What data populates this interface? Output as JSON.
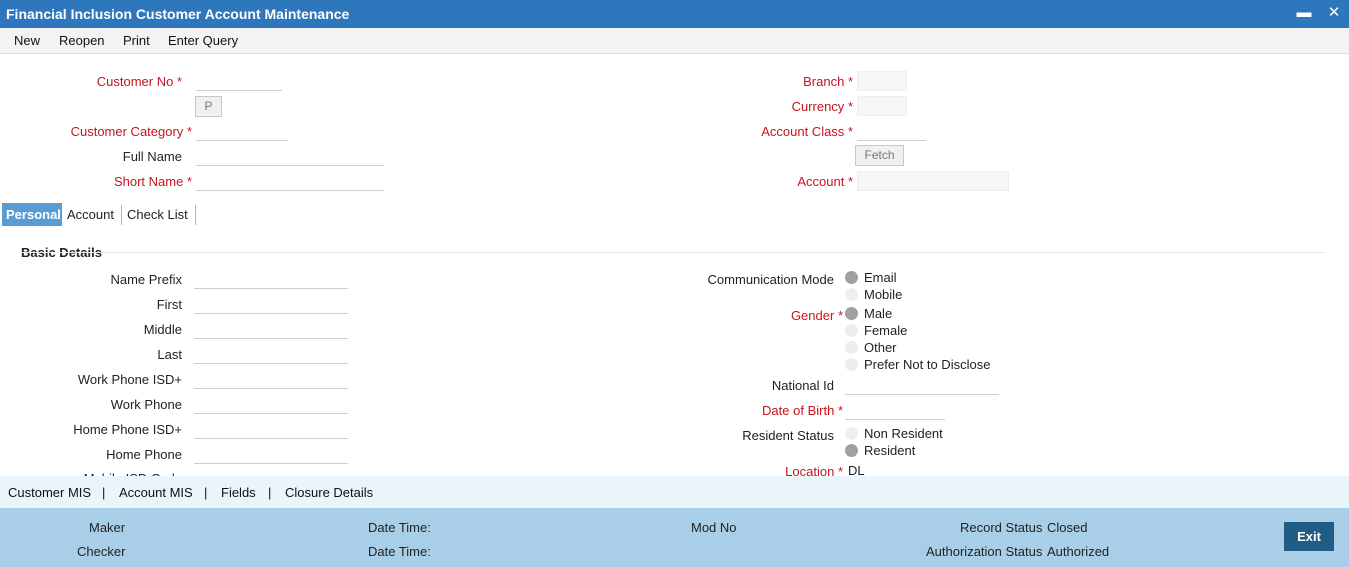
{
  "window": {
    "title": "Financial Inclusion Customer Account Maintenance",
    "minimize_icon": "minimize-icon",
    "close_icon": "close-icon"
  },
  "menu": [
    "New",
    "Reopen",
    "Print",
    "Enter Query"
  ],
  "header_form": {
    "customer_no": {
      "label": "Customer No",
      "required": "*",
      "value": ""
    },
    "p_button": "P",
    "customer_category": {
      "label": "Customer Category",
      "required": "*",
      "value": ""
    },
    "full_name": {
      "label": "Full Name",
      "value": ""
    },
    "short_name": {
      "label": "Short Name",
      "required": "*",
      "value": ""
    },
    "branch": {
      "label": "Branch",
      "required": "*",
      "value": ""
    },
    "currency": {
      "label": "Currency",
      "required": "*",
      "value": ""
    },
    "account_class": {
      "label": "Account Class",
      "required": "*",
      "value": ""
    },
    "fetch_button": "Fetch",
    "account": {
      "label": "Account",
      "required": "*",
      "value": ""
    }
  },
  "tabs": [
    "Personal",
    "Account",
    "Check List"
  ],
  "active_tab": "Personal",
  "basic_details": {
    "title": "Basic Details",
    "left_fields": [
      {
        "label": "Name Prefix",
        "value": ""
      },
      {
        "label": "First",
        "value": ""
      },
      {
        "label": "Middle",
        "value": ""
      },
      {
        "label": "Last",
        "value": ""
      },
      {
        "label": "Work Phone ISD+",
        "value": ""
      },
      {
        "label": "Work Phone",
        "value": ""
      },
      {
        "label": "Home Phone ISD+",
        "value": ""
      },
      {
        "label": "Home Phone",
        "value": ""
      },
      {
        "label": "Mobile ISD Code",
        "value": ""
      }
    ],
    "communication_mode": {
      "label": "Communication Mode",
      "options": [
        "Email",
        "Mobile"
      ],
      "selected": "Email"
    },
    "gender": {
      "label": "Gender",
      "required": "*",
      "options": [
        "Male",
        "Female",
        "Other",
        "Prefer Not to Disclose"
      ],
      "selected": "Male"
    },
    "national_id": {
      "label": "National Id",
      "value": ""
    },
    "date_of_birth": {
      "label": "Date of Birth",
      "required": "*",
      "value": ""
    },
    "resident_status": {
      "label": "Resident Status",
      "options": [
        "Non Resident",
        "Resident"
      ],
      "selected": "Resident"
    },
    "location": {
      "label": "Location",
      "required": "*",
      "value": "DL"
    }
  },
  "bottom_links": [
    "Customer MIS",
    "Account MIS",
    "Fields",
    "Closure Details"
  ],
  "bottom_separator": "|",
  "footer": {
    "maker_label": "Maker",
    "checker_label": "Checker",
    "date_time_label": "Date Time:",
    "mod_no_label": "Mod No",
    "record_status_label": "Record Status",
    "record_status_value": "Closed",
    "authorization_status_label": "Authorization Status",
    "authorization_status_value": "Authorized",
    "exit_button": "Exit"
  },
  "colors": {
    "title_bar": "#2f77bd",
    "required_label": "#c8141c",
    "active_tab": "#5a9bd4",
    "footer": "#a9cfe8",
    "exit_button": "#1f5c86"
  }
}
